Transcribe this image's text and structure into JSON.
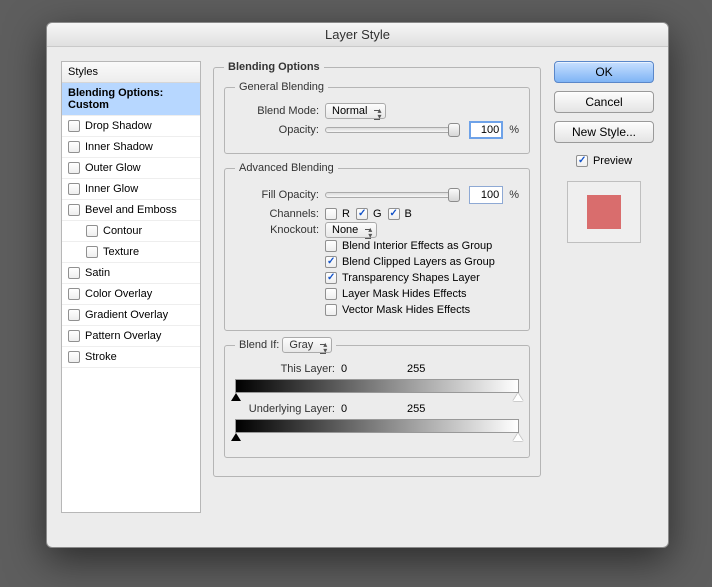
{
  "title": "Layer Style",
  "styles": {
    "header": "Styles",
    "selected": "Blending Options: Custom",
    "items": [
      "Drop Shadow",
      "Inner Shadow",
      "Outer Glow",
      "Inner Glow",
      "Bevel and Emboss",
      "Contour",
      "Texture",
      "Satin",
      "Color Overlay",
      "Gradient Overlay",
      "Pattern Overlay",
      "Stroke"
    ]
  },
  "options": {
    "title": "Blending Options",
    "general": {
      "title": "General Blending",
      "blend_mode_label": "Blend Mode:",
      "blend_mode_value": "Normal",
      "opacity_label": "Opacity:",
      "opacity_value": "100",
      "opacity_unit": "%"
    },
    "advanced": {
      "title": "Advanced Blending",
      "fill_opacity_label": "Fill Opacity:",
      "fill_opacity_value": "100",
      "fill_opacity_unit": "%",
      "channels_label": "Channels:",
      "channel_r": "R",
      "channel_r_checked": false,
      "channel_g": "G",
      "channel_g_checked": true,
      "channel_b": "B",
      "channel_b_checked": true,
      "knockout_label": "Knockout:",
      "knockout_value": "None",
      "opt1": {
        "label": "Blend Interior Effects as Group",
        "checked": false
      },
      "opt2": {
        "label": "Blend Clipped Layers as Group",
        "checked": true
      },
      "opt3": {
        "label": "Transparency Shapes Layer",
        "checked": true
      },
      "opt4": {
        "label": "Layer Mask Hides Effects",
        "checked": false
      },
      "opt5": {
        "label": "Vector Mask Hides Effects",
        "checked": false
      }
    },
    "blendif": {
      "label": "Blend If:",
      "value": "Gray",
      "this_layer_label": "This Layer:",
      "this_low": "0",
      "this_high": "255",
      "under_label": "Underlying Layer:",
      "under_low": "0",
      "under_high": "255"
    }
  },
  "buttons": {
    "ok": "OK",
    "cancel": "Cancel",
    "new_style": "New Style...",
    "preview": "Preview",
    "swatch_color": "#d96d6d"
  }
}
